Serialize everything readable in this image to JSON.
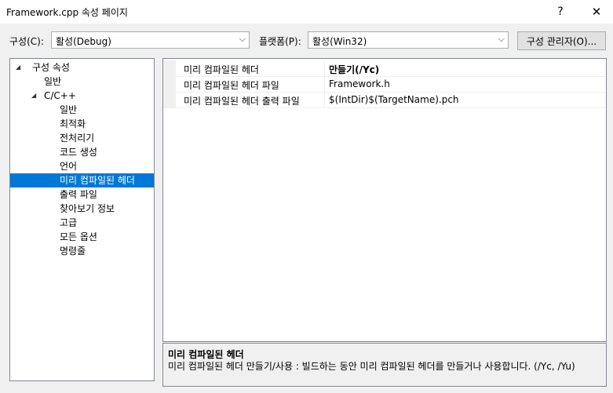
{
  "window": {
    "title": "Framework.cpp 속성 페이지",
    "help_glyph": "?",
    "close_glyph": "✕"
  },
  "toolbar": {
    "config_label": "구성(C):",
    "config_value": "활성(Debug)",
    "platform_label": "플랫폼(P):",
    "platform_value": "활성(Win32)",
    "manager_button": "구성 관리자(O)...",
    "dropdown_glyph": "⌵"
  },
  "tree": {
    "expanded_glyph": "◢",
    "items": [
      {
        "label": "구성 속성"
      },
      {
        "label": "일반"
      },
      {
        "label": "C/C++"
      },
      {
        "label": "일반"
      },
      {
        "label": "최적화"
      },
      {
        "label": "전처리기"
      },
      {
        "label": "코드 생성"
      },
      {
        "label": "언어"
      },
      {
        "label": "미리 컴파일된 헤더",
        "selected": true
      },
      {
        "label": "출력 파일"
      },
      {
        "label": "찾아보기 정보"
      },
      {
        "label": "고급"
      },
      {
        "label": "모든 옵션"
      },
      {
        "label": "명령줄"
      }
    ]
  },
  "grid": {
    "rows": [
      {
        "name": "미리 컴파일된 헤더",
        "value": "만들기(/Yc)",
        "bold": true
      },
      {
        "name": "미리 컴파일된 헤더 파일",
        "value": "Framework.h"
      },
      {
        "name": "미리 컴파일된 헤더 출력 파일",
        "value": "$(IntDir)$(TargetName).pch"
      }
    ]
  },
  "description": {
    "title": "미리 컴파일된 헤더",
    "text": "미리 컴파일된 헤더 만들기/사용 : 빌드하는 동안 미리 컴파일된 헤더를 만들거나 사용합니다.      (/Yc, /Yu)"
  }
}
